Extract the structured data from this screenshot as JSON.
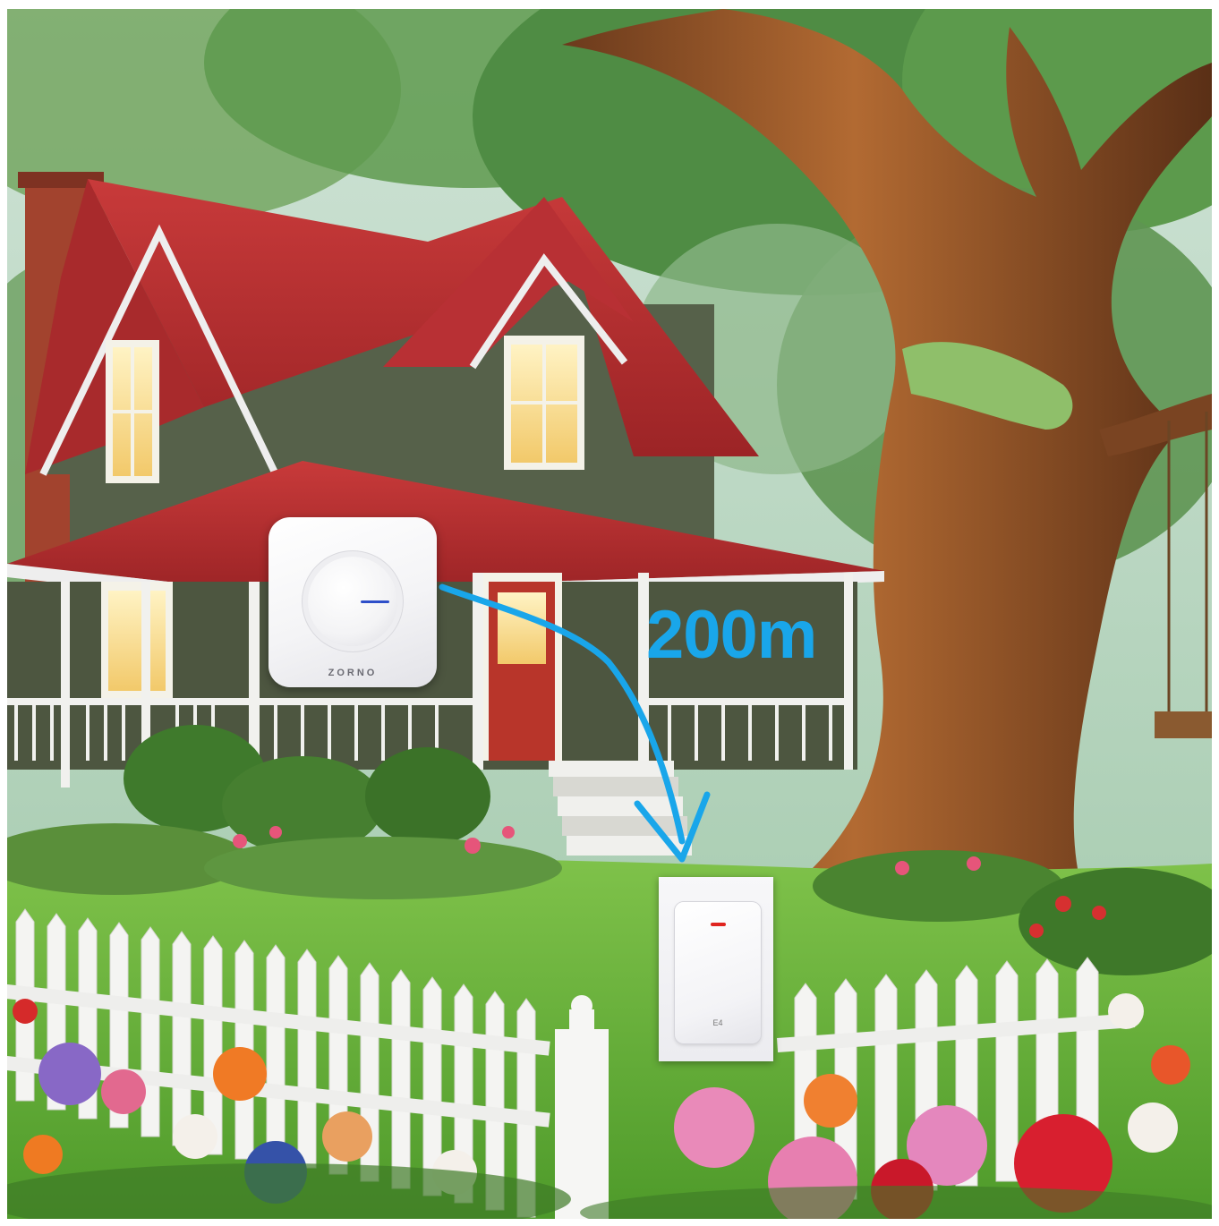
{
  "scene": {
    "description_icon": "house-garden-scene"
  },
  "chime": {
    "brand": "ZORNO",
    "led_color": "#2e4fc9"
  },
  "push_button": {
    "led_color": "#e0241f",
    "mark": "E4"
  },
  "range": {
    "label": "200m",
    "color": "#19a6ea"
  }
}
